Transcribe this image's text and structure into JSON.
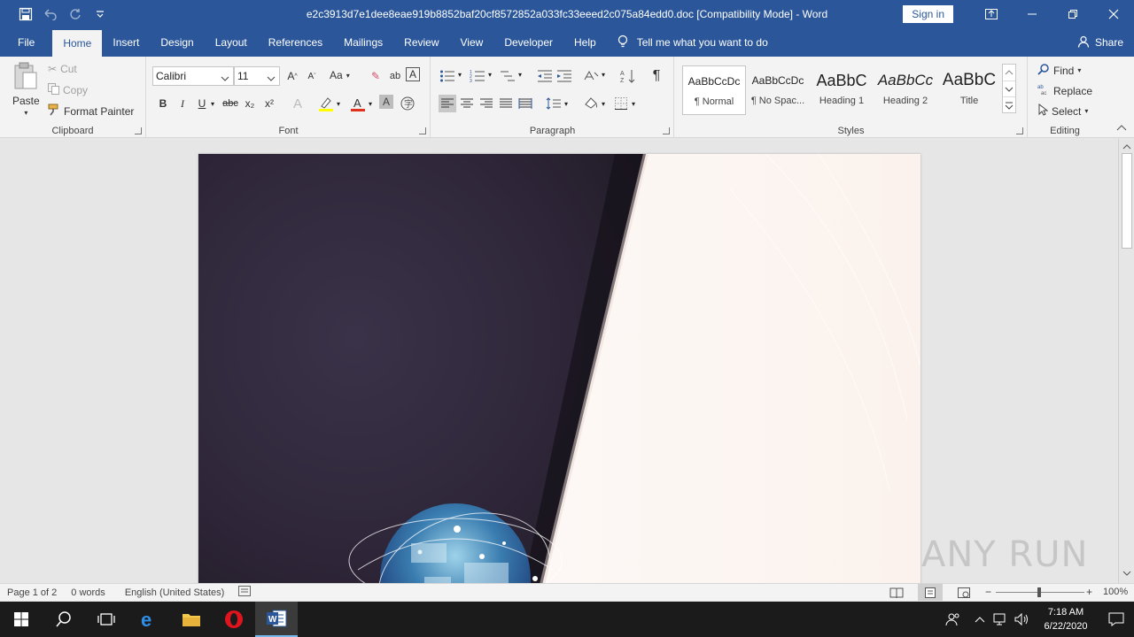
{
  "window": {
    "title": "e2c3913d7e1dee8eae919b8852baf20cf8572852a033fc33eeed2c075a84edd0.doc [Compatibility Mode]  -  Word",
    "sign_in": "Sign in"
  },
  "tabs": [
    "File",
    "Home",
    "Insert",
    "Design",
    "Layout",
    "References",
    "Mailings",
    "Review",
    "View",
    "Developer",
    "Help"
  ],
  "active_tab": "Home",
  "tell_me": "Tell me what you want to do",
  "share": "Share",
  "ribbon": {
    "clipboard": {
      "label": "Clipboard",
      "paste": "Paste",
      "cut": "Cut",
      "copy": "Copy",
      "format_painter": "Format Painter"
    },
    "font": {
      "label": "Font",
      "font_name": "Calibri",
      "font_size": "11",
      "bold": "B",
      "italic": "I",
      "underline": "U",
      "strike": "abc",
      "subscript": "x₂",
      "superscript": "x²",
      "change_case": "Aa"
    },
    "paragraph": {
      "label": "Paragraph"
    },
    "styles": {
      "label": "Styles",
      "items": [
        {
          "preview": "AaBbCcDc",
          "name": "¶ Normal"
        },
        {
          "preview": "AaBbCcDc",
          "name": "¶ No Spac..."
        },
        {
          "preview": "AaBbC",
          "name": "Heading 1"
        },
        {
          "preview": "AaBbCc",
          "name": "Heading 2"
        },
        {
          "preview": "AaBbC",
          "name": "Title"
        }
      ]
    },
    "editing": {
      "label": "Editing",
      "find": "Find",
      "replace": "Replace",
      "select": "Select"
    }
  },
  "status": {
    "page": "Page 1 of 2",
    "words": "0 words",
    "language": "English (United States)",
    "zoom": "100%"
  },
  "taskbar": {
    "time": "7:18 AM",
    "date": "6/22/2020"
  },
  "watermark": "ANY RUN",
  "colors": {
    "word_blue": "#2b579a",
    "ribbon_bg": "#f3f3f3",
    "taskbar_bg": "#1b1b1b"
  }
}
